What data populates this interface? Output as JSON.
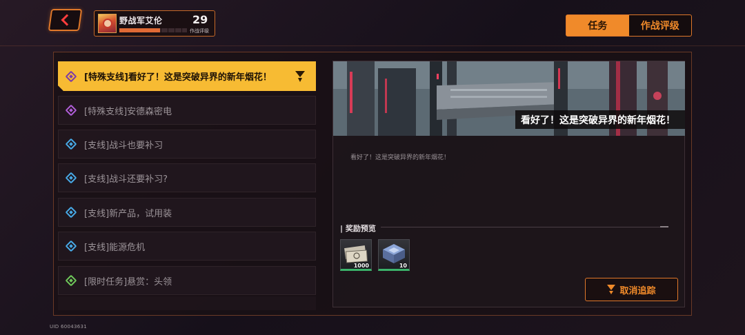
{
  "player": {
    "name": "野战军艾伦",
    "level": "29",
    "rank_label": "作战评级",
    "rank_progress": 0.6
  },
  "tabs": [
    {
      "label": "任务",
      "active": true
    },
    {
      "label": "作战评级",
      "active": false
    }
  ],
  "quests": [
    {
      "label": "[特殊支线]看好了！这是突破异界的新年烟花！",
      "icon": "purple-diamond-icon",
      "active": true,
      "tracked": true
    },
    {
      "label": "[特殊支线]安德森密电",
      "icon": "purple-diamond-icon",
      "active": false
    },
    {
      "label": "[支线]战斗也要补习",
      "icon": "blue-diamond-icon",
      "active": false
    },
    {
      "label": "[支线]战斗还要补习?",
      "icon": "blue-diamond-icon",
      "active": false
    },
    {
      "label": "[支线]新产品，试用装",
      "icon": "blue-diamond-icon",
      "active": false
    },
    {
      "label": "[支线]能源危机",
      "icon": "blue-diamond-icon",
      "active": false
    },
    {
      "label": "[限时任务]悬赏：头领",
      "icon": "green-diamond-icon",
      "active": false
    }
  ],
  "detail": {
    "banner_title": "看好了！这是突破异界的新年烟花！",
    "description": "看好了！这是突破异界的新年烟花！",
    "reward_header": "| 奖励预览",
    "rewards": [
      {
        "icon": "currency-notes-icon",
        "count": "1000"
      },
      {
        "icon": "material-box-icon",
        "count": "10"
      }
    ],
    "untrack_label": "取消追踪"
  },
  "uid": "UID 60043631",
  "colors": {
    "accent": "#f08a2a",
    "active_quest": "#f7bb33",
    "reward_border": "#3bb36a"
  }
}
